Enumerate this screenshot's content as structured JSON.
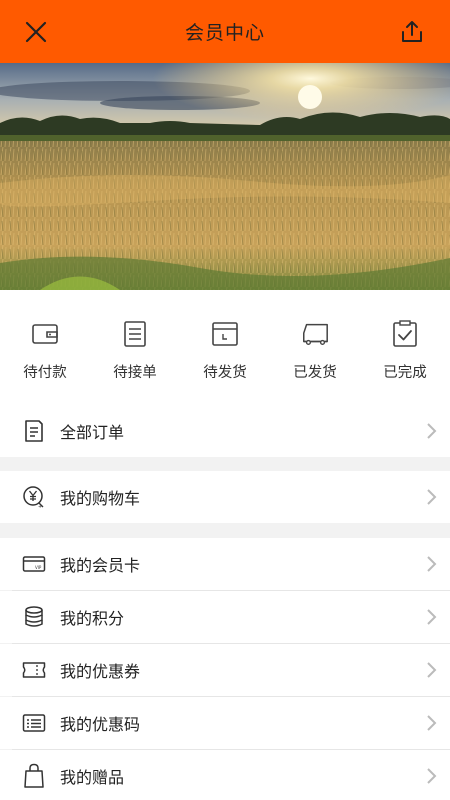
{
  "header": {
    "title": "会员中心",
    "close_icon": "close-icon",
    "share_icon": "share-icon",
    "background": "#ff5a00"
  },
  "banner": {
    "description_icon": "landscape-image"
  },
  "order_status": [
    {
      "label": "待付款",
      "icon": "wallet-icon"
    },
    {
      "label": "待接单",
      "icon": "document-list-icon"
    },
    {
      "label": "待发货",
      "icon": "package-icon"
    },
    {
      "label": "已发货",
      "icon": "truck-icon"
    },
    {
      "label": "已完成",
      "icon": "clipboard-check-icon"
    }
  ],
  "menu": {
    "all_orders": {
      "label": "全部订单",
      "icon": "order-list-icon"
    },
    "cart": {
      "label": "我的购物车",
      "icon": "cart-yen-icon"
    },
    "member_card": {
      "label": "我的会员卡",
      "icon": "vip-card-icon"
    },
    "points": {
      "label": "我的积分",
      "icon": "coins-icon"
    },
    "coupons": {
      "label": "我的优惠券",
      "icon": "coupon-icon"
    },
    "promo_codes": {
      "label": "我的优惠码",
      "icon": "code-list-icon"
    },
    "gifts": {
      "label": "我的赠品",
      "icon": "gift-bag-icon"
    }
  }
}
